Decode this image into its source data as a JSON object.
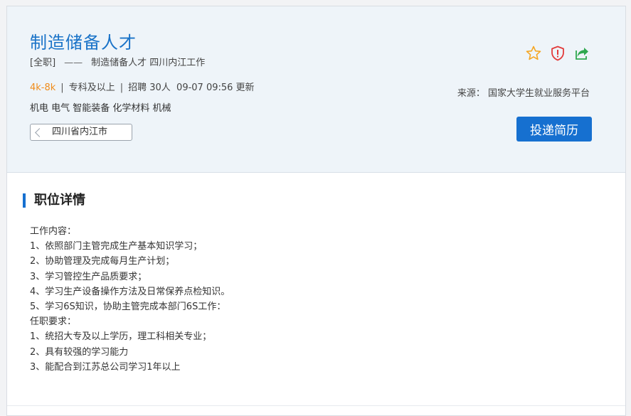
{
  "job": {
    "title": "制造储备人才",
    "type": "[全职]",
    "dash": "——",
    "subtitle": "制造储备人才 四川内江工作",
    "salary": "4k-8k",
    "sep": "|",
    "education": "专科及以上",
    "recruit": "招聘 30人",
    "updated": "09-07 09:56 更新",
    "tags": "机电 电气 智能装备 化学材料 机械",
    "location": "四川省内江市"
  },
  "source": {
    "text": "来源：  国家大学生就业服务平台"
  },
  "actions": {
    "apply_label": "投递简历",
    "icons": [
      "star-icon",
      "shield-alert-icon",
      "share-icon"
    ]
  },
  "section": {
    "title": "职位详情"
  },
  "description": [
    "工作内容：",
    "1、依照部门主管完成生产基本知识学习；",
    "2、协助管理及完成每月生产计划；",
    "3、学习管控生产品质要求；",
    "4、学习生产设备操作方法及日常保养点检知识。",
    "5、学习6S知识，协助主管完成本部门6S工作：",
    "任职要求：",
    "1、统招大专及以上学历，理工科相关专业；",
    "2、具有较强的学习能力",
    "3、能配合到江苏总公司学习1年以上"
  ],
  "colors": {
    "title": "#1a73c8",
    "salary": "#f08c1a",
    "button": "#1670d0",
    "star": "#f5a623",
    "shield": "#e23b3b",
    "share": "#2fa84f"
  }
}
